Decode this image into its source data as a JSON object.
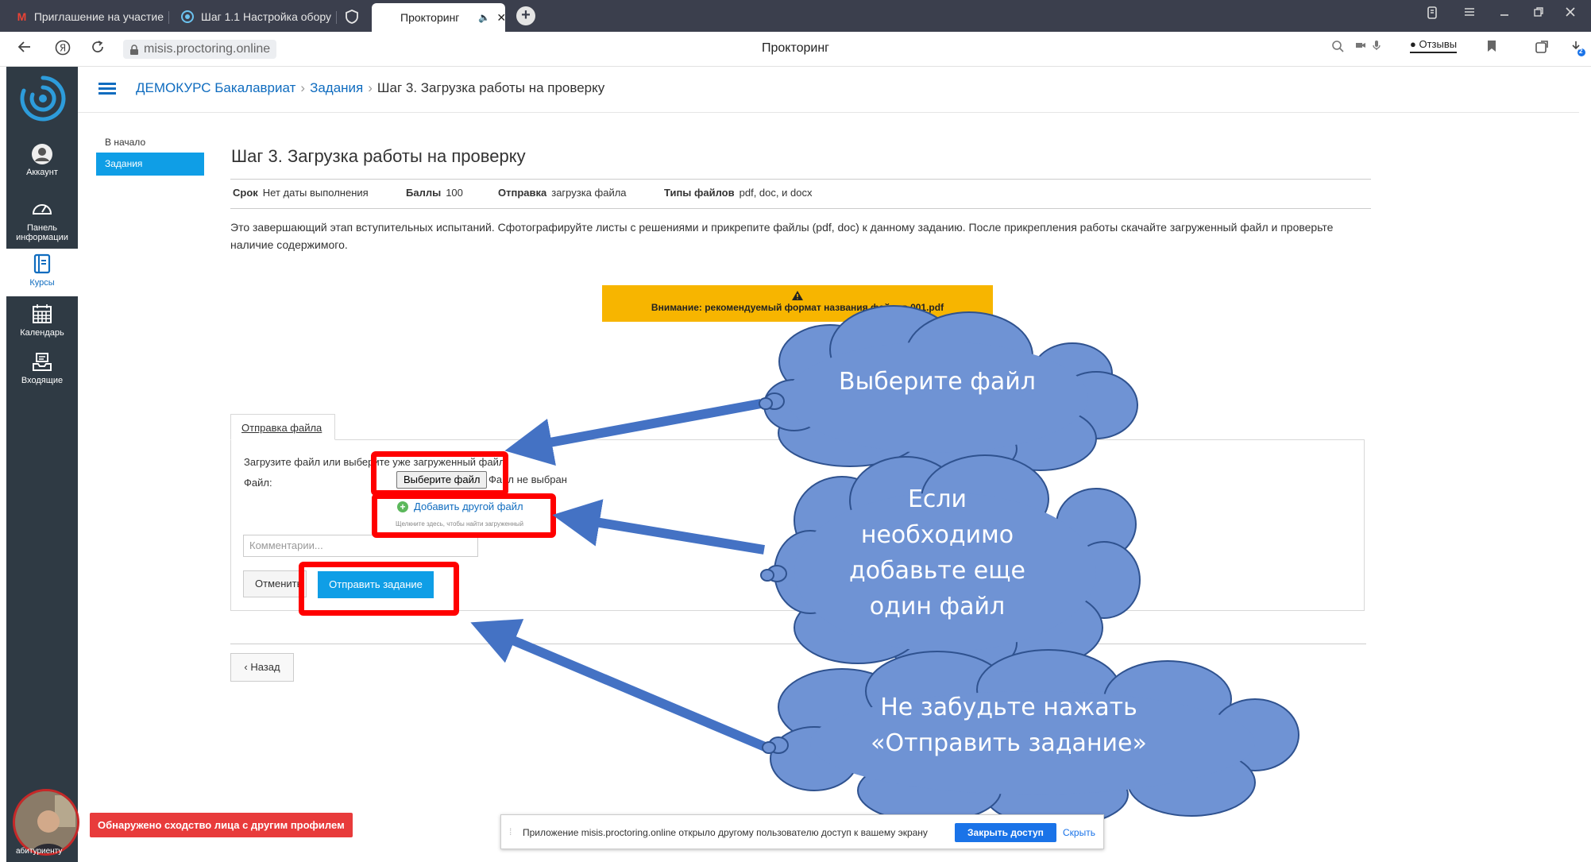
{
  "browser": {
    "tabs": [
      {
        "label": "Приглашение на участие",
        "icon": "gmail-icon"
      },
      {
        "label": "Шаг 1.1 Настройка обору",
        "icon": "proctoring-site-icon"
      },
      {
        "label": "",
        "icon": "shield-icon"
      },
      {
        "label": "Прокторинг",
        "icon": "",
        "audio": "🔈",
        "close": "✕"
      }
    ],
    "new_tab": "+",
    "url": "misis.proctoring.online",
    "page_title": "Прокторинг",
    "reviews_label": "Отзывы",
    "download_badge": "2"
  },
  "sidebar": {
    "items": [
      {
        "label": "Аккаунт",
        "icon": "user-avatar-icon"
      },
      {
        "label": "Панель информации",
        "icon": "dashboard-gauge-icon"
      },
      {
        "label": "Курсы",
        "icon": "courses-icon"
      },
      {
        "label": "Календарь",
        "icon": "calendar-icon"
      },
      {
        "label": "Входящие",
        "icon": "inbox-icon"
      }
    ]
  },
  "breadcrumb": {
    "course": "ДЕМОКУРС Бакалавриат",
    "section": "Задания",
    "current": "Шаг 3. Загрузка работы на проверку",
    "separator": "›"
  },
  "leftnav": {
    "home": "В начало",
    "active": "Задания"
  },
  "assignment": {
    "title": "Шаг 3. Загрузка работы на проверку",
    "meta": [
      {
        "label": "Срок",
        "value": "Нет даты выполнения"
      },
      {
        "label": "Баллы",
        "value": "100"
      },
      {
        "label": "Отправка",
        "value": "загрузка файла"
      },
      {
        "label": "Типы файлов",
        "value": "pdf, doc, и docx"
      }
    ],
    "description": "Это завершающий этап вступительных испытаний. Сфотографируйте листы с решениями и прикрепите файлы (pdf, doc) к данному заданию. После прикрепления работы скачайте загруженный файл и проверьте наличие содержимого.",
    "warning": "Внимание: рекомендуемый формат названия файлов 001.pdf"
  },
  "upload": {
    "tab": "Отправка файла",
    "hint": "Загрузите файл или выберите уже загруженный файл",
    "file_label": "Файл:",
    "choose_button": "Выберите файл",
    "no_file": "Файл не выбран",
    "add_file": "Добавить другой файл",
    "add_hint": "Щелкните здесь, чтобы найти загруженный",
    "comment_placeholder": "Комментарии...",
    "cancel": "Отменить",
    "submit": "Отправить задание",
    "back": "‹ Назад"
  },
  "callouts": {
    "choose": "Выберите файл",
    "add": [
      "Если",
      "необходимо",
      "добавьте еще",
      "один файл"
    ],
    "submit": [
      "Не забудьте нажать",
      "«Отправить задание»"
    ]
  },
  "proctor": {
    "face_alert": "Обнаружено сходство лица с другим профилем",
    "username": "абитуриенту"
  },
  "sharebar": {
    "message": "Приложение misis.proctoring.online открыло другому пользователю доступ к вашему экрану",
    "close_access": "Закрыть доступ",
    "hide": "Скрыть"
  },
  "colors": {
    "accent": "#0f9ee6",
    "link": "#0f6cbf",
    "sidebar": "#2f3a44",
    "warning": "#f7b500",
    "highlight": "#ff0000",
    "cloud": "#6f93d4",
    "arrow": "#4472c4"
  }
}
